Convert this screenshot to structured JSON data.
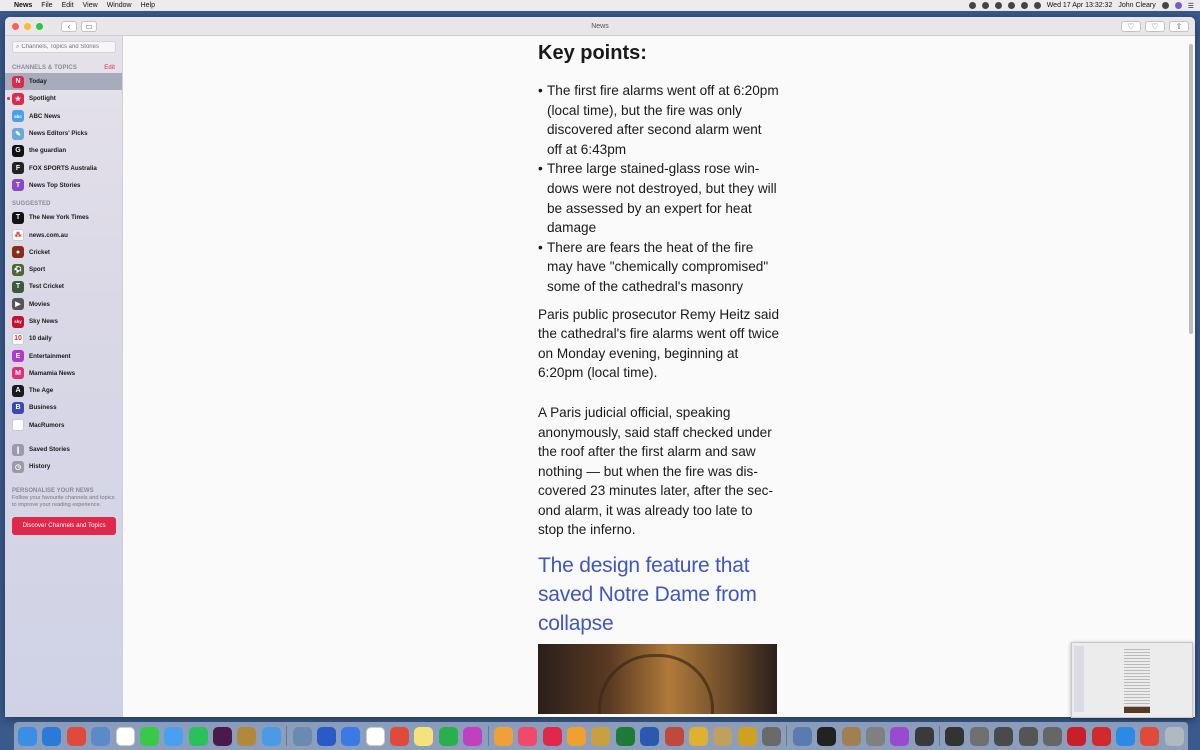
{
  "menubar": {
    "app_name": "News",
    "menus": [
      "File",
      "Edit",
      "View",
      "Window",
      "Help"
    ],
    "clock": "Wed 17 Apr  13:32:32",
    "user": "John Cleary"
  },
  "window": {
    "title": "News"
  },
  "sidebar": {
    "search_placeholder": "Channels, Topics and Stories",
    "channels_header": "CHANNELS & TOPICS",
    "edit_label": "Edit",
    "channels": [
      {
        "label": "Today",
        "icon": "today-icon",
        "color": "#e0294a",
        "glyph": "N",
        "active": true
      },
      {
        "label": "Spotlight",
        "icon": "spotlight-icon",
        "color": "#e0294a",
        "glyph": "★",
        "dot": true
      },
      {
        "label": "ABC News",
        "icon": "abc-news-icon",
        "color": "#4aa0e6",
        "glyph": "abc"
      },
      {
        "label": "News Editors' Picks",
        "icon": "editors-picks-icon",
        "color": "#6aa8d8",
        "glyph": "✎"
      },
      {
        "label": "the guardian",
        "icon": "guardian-icon",
        "color": "#111111",
        "glyph": "G"
      },
      {
        "label": "FOX SPORTS Australia",
        "icon": "fox-sports-icon",
        "color": "#222222",
        "glyph": "F"
      },
      {
        "label": "News Top Stories",
        "icon": "top-stories-icon",
        "color": "#8a4ac8",
        "glyph": "T"
      }
    ],
    "suggested_header": "SUGGESTED",
    "suggested": [
      {
        "label": "The New York Times",
        "icon": "nyt-icon",
        "color": "#111111",
        "glyph": "T"
      },
      {
        "label": "news.com.au",
        "icon": "news-com-au-icon",
        "color": "#ffffff",
        "glyph": "⁂"
      },
      {
        "label": "Cricket",
        "icon": "cricket-icon",
        "color": "#8a2a1a",
        "glyph": "●"
      },
      {
        "label": "Sport",
        "icon": "sport-icon",
        "color": "#4a6a2a",
        "glyph": "⚽"
      },
      {
        "label": "Test Cricket",
        "icon": "test-cricket-icon",
        "color": "#3a5a3a",
        "glyph": "T"
      },
      {
        "label": "Movies",
        "icon": "movies-icon",
        "color": "#555555",
        "glyph": "▶"
      },
      {
        "label": "Sky News",
        "icon": "sky-news-icon",
        "color": "#c8102e",
        "glyph": "sky"
      },
      {
        "label": "10 daily",
        "icon": "ten-daily-icon",
        "color": "#ffffff",
        "glyph": "10"
      },
      {
        "label": "Entertainment",
        "icon": "entertainment-icon",
        "color": "#b03ad0",
        "glyph": "E"
      },
      {
        "label": "Mamamia News",
        "icon": "mamamia-icon",
        "color": "#e0307a",
        "glyph": "M"
      },
      {
        "label": "The Age",
        "icon": "the-age-icon",
        "color": "#1a1a1a",
        "glyph": "A"
      },
      {
        "label": "Business",
        "icon": "business-icon",
        "color": "#3a4ab0",
        "glyph": "B"
      },
      {
        "label": "MacRumors",
        "icon": "macrumors-icon",
        "color": "#ffffff",
        "glyph": ""
      }
    ],
    "extras": [
      {
        "label": "Saved Stories",
        "icon": "bookmark-icon",
        "color": "#9a9aa8",
        "glyph": "❙"
      },
      {
        "label": "History",
        "icon": "history-icon",
        "color": "#9a9aa8",
        "glyph": "◷"
      }
    ],
    "personalise_header": "PERSONALISE YOUR NEWS",
    "personalise_text": "Follow your favourite channels and topics to improve your reading experience.",
    "discover_button": "Discover Channels and Topics"
  },
  "article": {
    "key_points_heading": "Key points:",
    "bullets": [
      "The first fire alarms went off at 6:20pm (local time), but the fire was only discovered after second alarm went off at 6:43pm",
      "Three large stained-glass rose win-dows were not destroyed, but they will be assessed by an expert for heat damage",
      "There are fears the heat of the fire may have \"chemically compromised\" some of the cathedral's masonry"
    ],
    "paragraph_1": "Paris public prosecutor Remy Heitz said the cathedral's fire alarms went off twice on Monday evening, beginning at 6:20pm (local time).",
    "paragraph_2": "A Paris judicial official, speaking anonymously, said staff checked under the roof after the first alarm and saw nothing — but when the fire was dis-covered 23 minutes later, after the sec-ond alarm, it was already too late to stop the inferno.",
    "subheading": "The design feature that saved Notre Dame from collapse"
  },
  "colors": {
    "accent": "#e0294a",
    "link_heading": "#3f57c0"
  },
  "dock": [
    {
      "name": "finder",
      "color": "#3a8ee6"
    },
    {
      "name": "safari",
      "color": "#2a7ad8"
    },
    {
      "name": "chrome",
      "color": "#e04a3a"
    },
    {
      "name": "preview",
      "color": "#5a8ac8"
    },
    {
      "name": "calendar",
      "color": "#ffffff"
    },
    {
      "name": "facetime",
      "color": "#3ac84a"
    },
    {
      "name": "messages",
      "color": "#4aa0f0"
    },
    {
      "name": "whatsapp",
      "color": "#2ac05a"
    },
    {
      "name": "slack",
      "color": "#4a1a4a"
    },
    {
      "name": "notebook",
      "color": "#b08a3a"
    },
    {
      "name": "tweetbot",
      "color": "#4a9ae6"
    },
    {
      "name": "sep",
      "color": ""
    },
    {
      "name": "pointer",
      "color": "#6a8ab0"
    },
    {
      "name": "onepassword",
      "color": "#2a5ac8"
    },
    {
      "name": "things",
      "color": "#3a7ae6"
    },
    {
      "name": "reminders",
      "color": "#ffffff"
    },
    {
      "name": "fantastical",
      "color": "#e04a3a"
    },
    {
      "name": "notes",
      "color": "#f6e27a"
    },
    {
      "name": "evernote",
      "color": "#2ab04a"
    },
    {
      "name": "flower",
      "color": "#c040c0"
    },
    {
      "name": "sep",
      "color": ""
    },
    {
      "name": "photos",
      "color": "#f0a03a"
    },
    {
      "name": "music",
      "color": "#f04a6a"
    },
    {
      "name": "news",
      "color": "#e0294a"
    },
    {
      "name": "pages",
      "color": "#f0a030"
    },
    {
      "name": "keynote",
      "color": "#c8a040"
    },
    {
      "name": "excel",
      "color": "#1f7a3a"
    },
    {
      "name": "word",
      "color": "#2a5ab0"
    },
    {
      "name": "mosaic",
      "color": "#c04a3a"
    },
    {
      "name": "app-a",
      "color": "#e0b030"
    },
    {
      "name": "app-b",
      "color": "#c0a060"
    },
    {
      "name": "app-c",
      "color": "#d0a020"
    },
    {
      "name": "app-d",
      "color": "#6a6a6a"
    },
    {
      "name": "sep",
      "color": ""
    },
    {
      "name": "system",
      "color": "#5a7ab0"
    },
    {
      "name": "terminal",
      "color": "#222222"
    },
    {
      "name": "app-e",
      "color": "#a08050"
    },
    {
      "name": "app-f",
      "color": "#808080"
    },
    {
      "name": "app-g",
      "color": "#9a4ad0"
    },
    {
      "name": "app-h",
      "color": "#3a3a3a"
    },
    {
      "name": "sep",
      "color": ""
    },
    {
      "name": "app-i",
      "color": "#333333"
    },
    {
      "name": "app-j",
      "color": "#707070"
    },
    {
      "name": "app-k",
      "color": "#4a4a4a"
    },
    {
      "name": "app-l",
      "color": "#555555"
    },
    {
      "name": "app-m",
      "color": "#666666"
    },
    {
      "name": "acrobat",
      "color": "#c8202a"
    },
    {
      "name": "app-n",
      "color": "#d02a2a"
    },
    {
      "name": "appstore",
      "color": "#2a8ae6"
    },
    {
      "name": "apple",
      "color": "#e04a3a"
    },
    {
      "name": "trash",
      "color": "#b0b8c0"
    }
  ]
}
